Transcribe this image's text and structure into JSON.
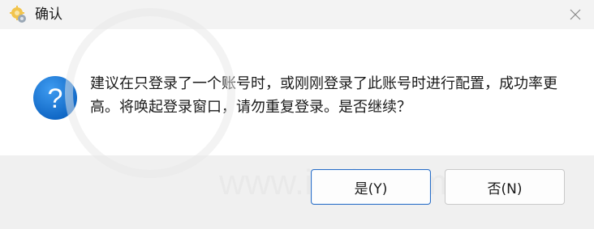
{
  "window": {
    "title": "确认",
    "icon": "settings-app-icon",
    "close_icon": "close-icon"
  },
  "message": {
    "icon": "question-icon",
    "icon_glyph": "?",
    "text": "建议在只登录了一个账号时，或刚刚登录了此账号时进行配置，成功率更高。将唤起登录窗口，请勿重复登录。是否继续？"
  },
  "buttons": {
    "yes_label": "是(Y)",
    "no_label": "否(N)"
  },
  "watermark": {
    "url": "www.i3zh.com"
  },
  "colors": {
    "accent": "#2b6fc7",
    "question_icon": "#1a78d6"
  }
}
